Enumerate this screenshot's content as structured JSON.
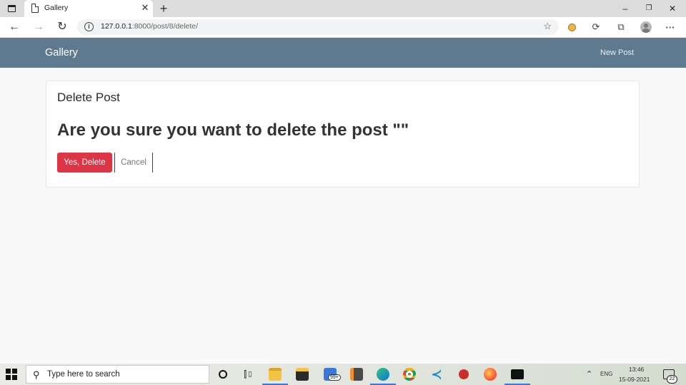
{
  "browser": {
    "tab": {
      "title": "Gallery",
      "close_label": "✕"
    },
    "new_tab_label": "+",
    "window_controls": {
      "minimize": "–",
      "restore": "❐",
      "close": "✕"
    },
    "url": {
      "host": "127.0.0.1",
      "path": ":8000/post/8/delete/"
    }
  },
  "navbar": {
    "brand": "Gallery",
    "new_post_label": "New Post",
    "background_color": "#5f7a8e"
  },
  "card": {
    "title": "Delete Post",
    "heading": "Are you sure you want to delete the post \"\"",
    "confirm_button": "Yes, Delete",
    "cancel_button": "Cancel",
    "danger_color": "#dc3545"
  },
  "taskbar": {
    "search_placeholder": "Type here to search",
    "mail_badge": "99+",
    "language": "ENG",
    "time": "13:46",
    "date": "15-09-2021",
    "notification_count": "22",
    "icons": [
      "windows-start-icon",
      "cortana-icon",
      "task-view-icon",
      "file-explorer-icon",
      "store-icon",
      "mail-icon",
      "sublime-text-icon",
      "edge-icon",
      "chrome-icon",
      "vscode-icon",
      "app-icon",
      "firefox-icon",
      "terminal-icon"
    ]
  }
}
